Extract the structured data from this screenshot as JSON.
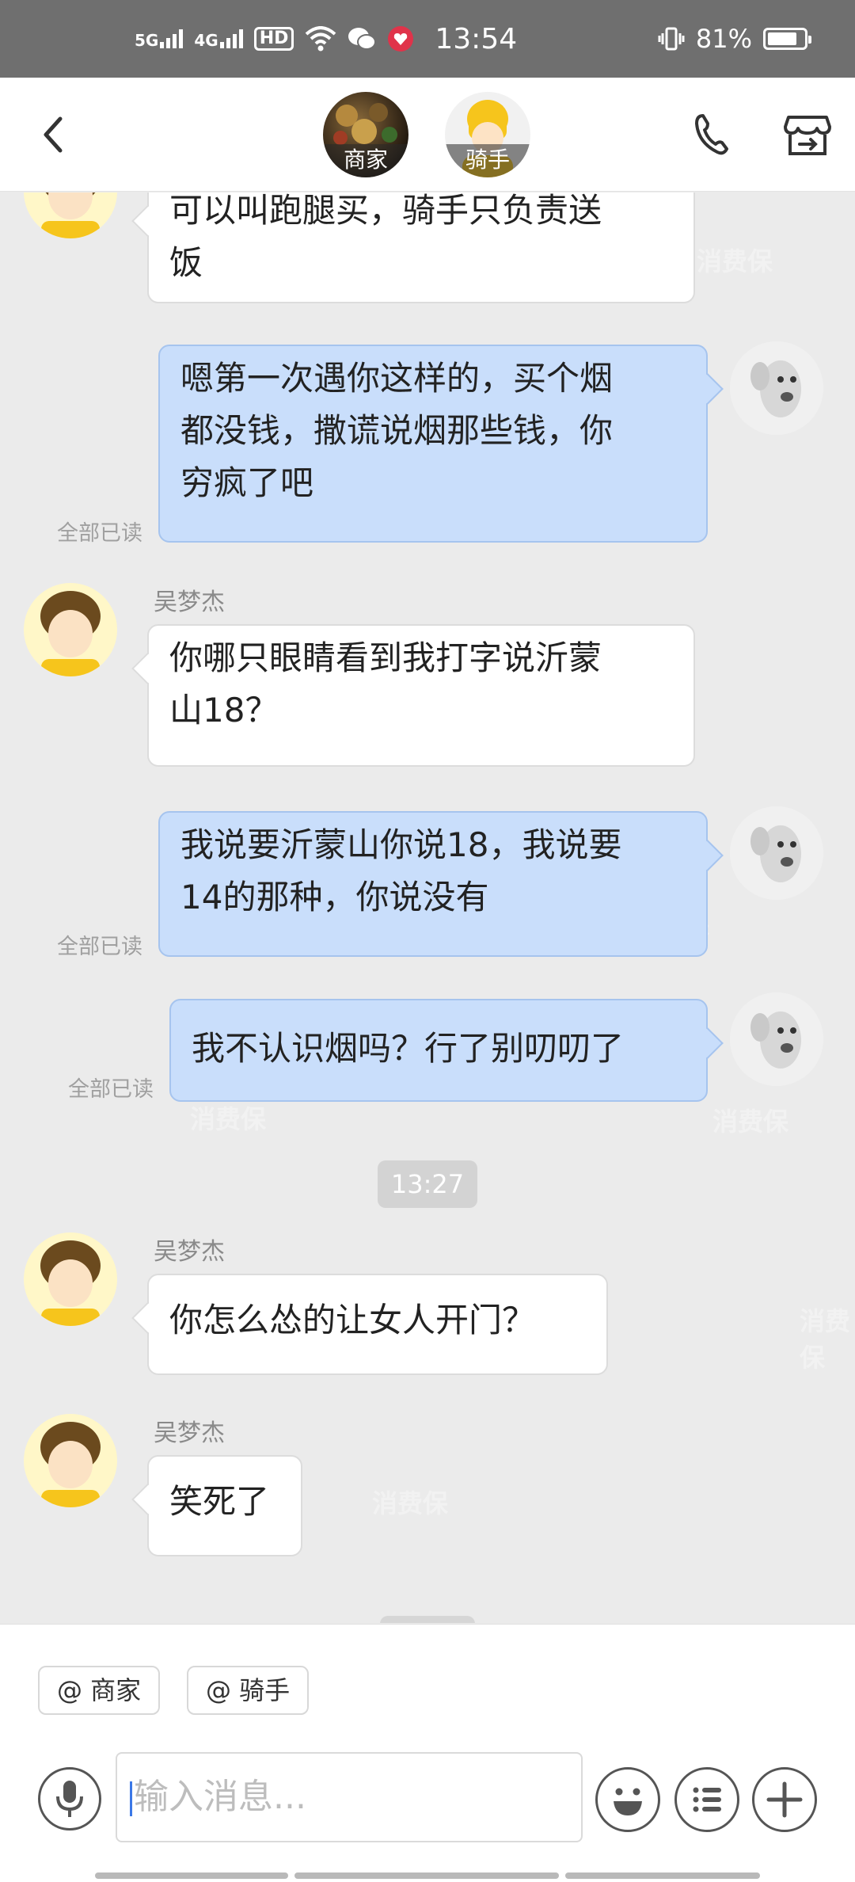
{
  "status_bar": {
    "network_1": "5G",
    "network_2": "4G",
    "hd": "HD",
    "time": "13:54",
    "battery": "81%",
    "battery_level": 0.81
  },
  "header": {
    "merchant_label": "商家",
    "rider_label": "骑手"
  },
  "messages": [
    {
      "type": "in",
      "text_lines": [
        "可以叫跑腿买，骑手只负责送",
        "饭"
      ]
    },
    {
      "type": "out",
      "text_lines": [
        "嗯第一次遇你这样的，买个烟",
        "都没钱，撒谎说烟那些钱，你",
        "穷疯了吧"
      ],
      "read": "全部已读"
    },
    {
      "type": "in",
      "sender": "吴梦杰",
      "text_lines": [
        "你哪只眼睛看到我打字说沂蒙",
        "山18？"
      ]
    },
    {
      "type": "out",
      "text_lines": [
        "我说要沂蒙山你说18，我说要",
        "14的那种，你说没有"
      ],
      "read": "全部已读"
    },
    {
      "type": "out",
      "text_lines": [
        "我不认识烟吗？行了别叨叨了"
      ],
      "read": "全部已读"
    },
    {
      "type": "time",
      "text": "13:27"
    },
    {
      "type": "in",
      "sender": "吴梦杰",
      "text_lines": [
        "你怎么怂的让女人开门？"
      ]
    },
    {
      "type": "in",
      "sender": "吴梦杰",
      "text_lines": [
        "笑死了"
      ]
    }
  ],
  "bottom": {
    "mention_merchant": "@ 商家",
    "mention_rider": "@ 骑手",
    "input_placeholder": "输入消息..."
  },
  "watermark": "消费保",
  "colors": {
    "status_bar": "#6f6f6f",
    "out_bubble": "#c9defb",
    "in_bubble": "#ffffff",
    "chat_bg": "#ebebeb"
  }
}
